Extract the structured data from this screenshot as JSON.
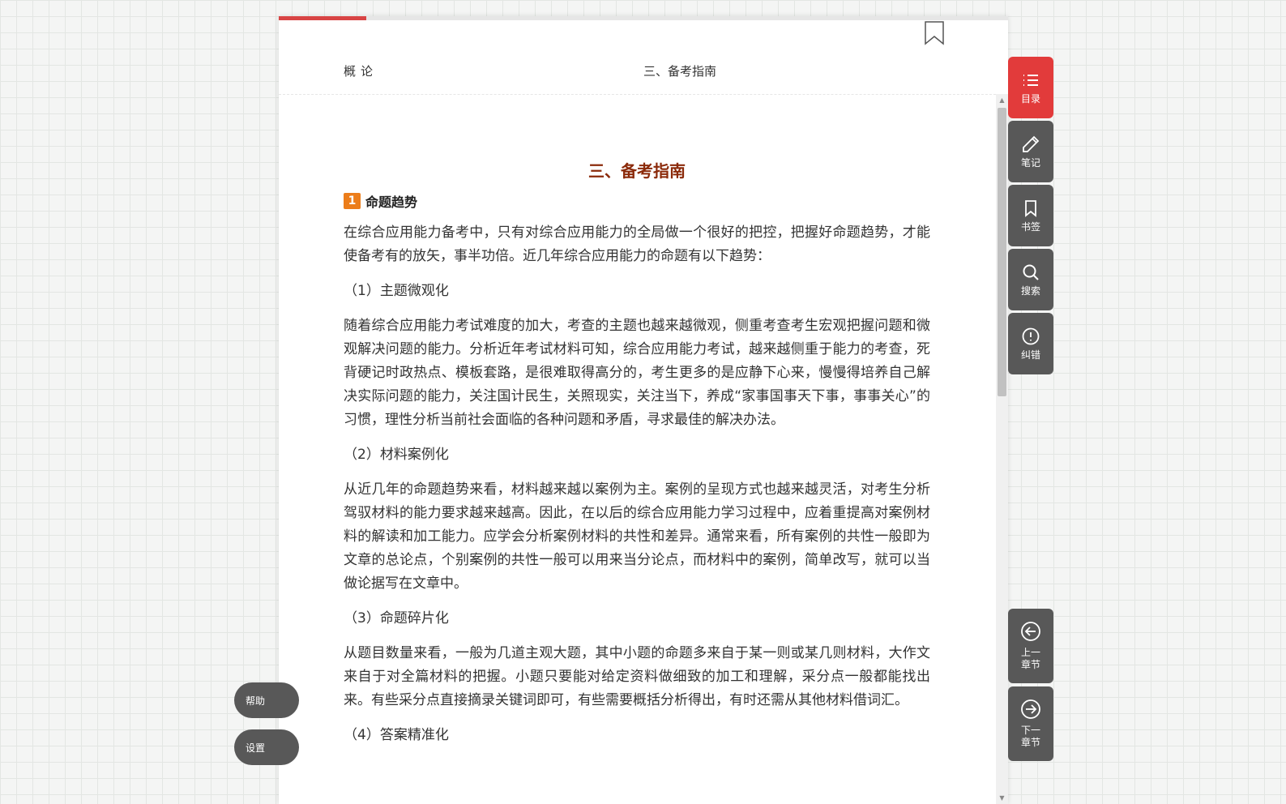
{
  "reader": {
    "progress_percent": 12,
    "header_left": "概论",
    "header_center": "三、备考指南"
  },
  "article": {
    "chapter_title": "三、备考指南",
    "section_number": "1",
    "section_title": "命题趋势",
    "intro": "在综合应用能力备考中，只有对综合应用能力的全局做一个很好的把控，把握好命题趋势，才能使备考有的放矢，事半功倍。近几年综合应用能力的命题有以下趋势：",
    "items": [
      {
        "title": "（1）主题微观化",
        "body": "随着综合应用能力考试难度的加大，考查的主题也越来越微观，侧重考查考生宏观把握问题和微观解决问题的能力。分析近年考试材料可知，综合应用能力考试，越来越侧重于能力的考查，死背硬记时政热点、模板套路，是很难取得高分的，考生更多的是应静下心来，慢慢得培养自己解决实际问题的能力，关注国计民生，关照现实，关注当下，养成“家事国事天下事，事事关心”的习惯，理性分析当前社会面临的各种问题和矛盾，寻求最佳的解决办法。"
      },
      {
        "title": "（2）材料案例化",
        "body": "从近几年的命题趋势来看，材料越来越以案例为主。案例的呈现方式也越来越灵活，对考生分析驾驭材料的能力要求越来越高。因此，在以后的综合应用能力学习过程中，应着重提高对案例材料的解读和加工能力。应学会分析案例材料的共性和差异。通常来看，所有案例的共性一般即为文章的总论点，个别案例的共性一般可以用来当分论点，而材料中的案例，简单改写，就可以当做论据写在文章中。"
      },
      {
        "title": "（3）命题碎片化",
        "body": "从题目数量来看，一般为几道主观大题，其中小题的命题多来自于某一则或某几则材料，大作文来自于对全篇材料的把握。小题只要能对给定资料做细致的加工和理解，采分点一般都能找出来。有些采分点直接摘录关键词即可，有些需要概括分析得出，有时还需从其他材料借词汇。"
      },
      {
        "title": "（4）答案精准化",
        "body": ""
      }
    ]
  },
  "side_tools": [
    {
      "label": "目录",
      "icon": "list-icon"
    },
    {
      "label": "笔记",
      "icon": "pencil-icon"
    },
    {
      "label": "书签",
      "icon": "bookmark-icon"
    },
    {
      "label": "搜索",
      "icon": "search-icon"
    },
    {
      "label": "纠错",
      "icon": "alert-icon"
    }
  ],
  "nav": {
    "prev_label": "上一章节",
    "next_label": "下一章节"
  },
  "pills": {
    "help": "帮助",
    "settings": "设置"
  },
  "colors": {
    "accent": "#e23b3b",
    "title": "#8b2a0a",
    "badge": "#ec7d1a",
    "tool_bg": "#585858"
  }
}
